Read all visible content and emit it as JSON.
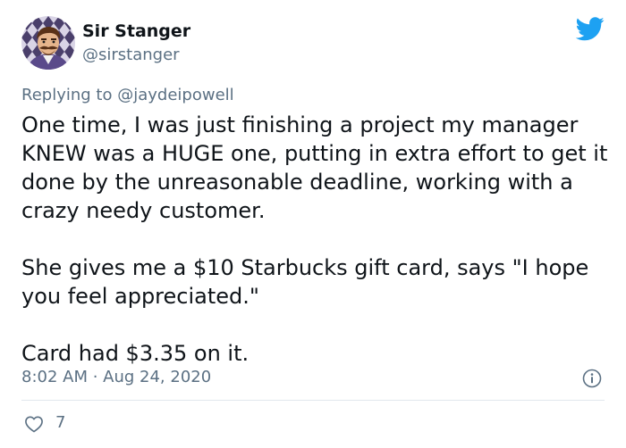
{
  "author": {
    "display_name": "Sir Stanger",
    "handle": "@sirstanger",
    "avatar_icon": "cartoon-mustache-man-avatar"
  },
  "reply": {
    "prefix": "Replying to",
    "mention": "@jaydeipowell"
  },
  "tweet": {
    "paragraphs": [
      "One time, I was just finishing a project my manager KNEW was a HUGE one, putting in extra effort to get it done by the unreasonable deadline, working with a crazy needy customer.",
      "She gives me a $10 Starbucks gift card, says \"I hope you feel appreciated.\"",
      "Card had $3.35 on it."
    ],
    "timestamp": "8:02 AM · Aug 24, 2020",
    "like_count": "7"
  },
  "icons": {
    "brand": "twitter-bird-icon",
    "info": "info-icon",
    "like": "heart-icon"
  },
  "colors": {
    "brand": "#1da1f2",
    "text": "#0f1419",
    "secondary": "#5b7083",
    "divider": "#e1e8ed"
  }
}
